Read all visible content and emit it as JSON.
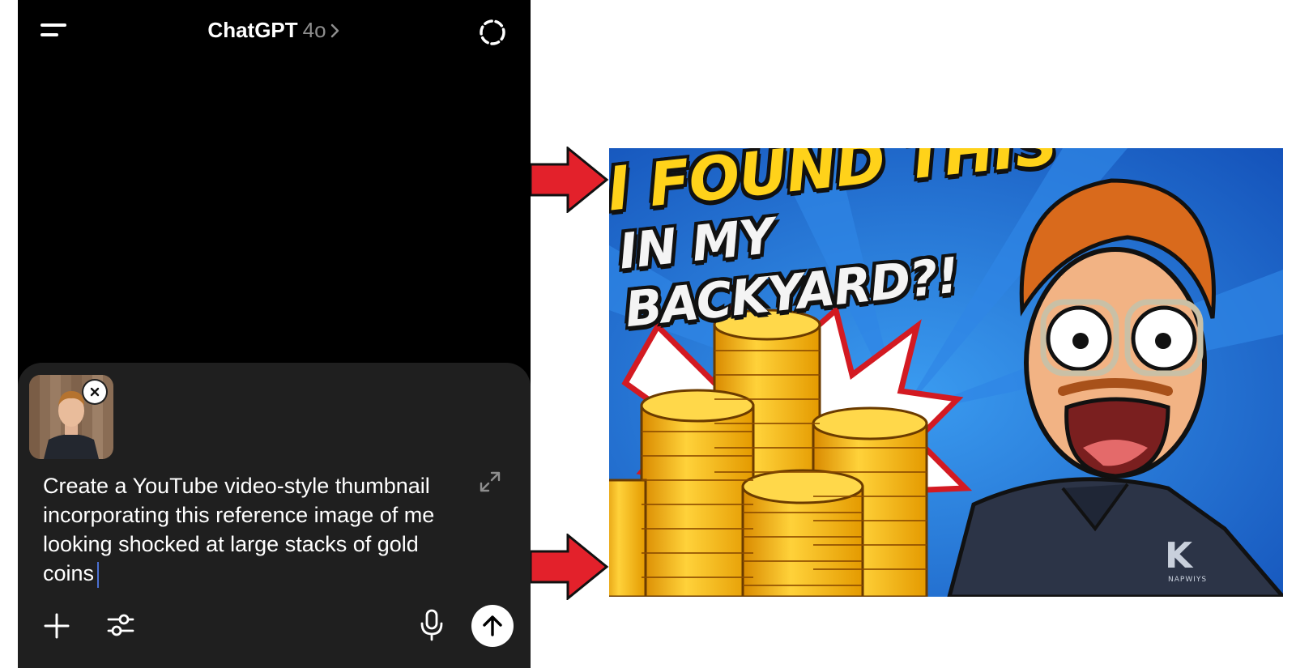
{
  "header": {
    "title": "ChatGPT",
    "model": "4o",
    "menu_icon": "menu-icon",
    "chat_icon": "temporary-chat-icon"
  },
  "composer": {
    "attachment": {
      "kind": "reference-photo",
      "close_icon": "close-icon"
    },
    "prompt_text": "Create a YouTube video-style thumbnail incorporating this reference image of me looking shocked at large stacks of gold coins",
    "expand_icon": "expand-icon",
    "plus_icon": "plus-icon",
    "tools_icon": "sliders-icon",
    "mic_icon": "microphone-icon",
    "send_icon": "arrow-up-icon"
  },
  "annotations": {
    "arrow_color": "#e3212b"
  },
  "thumbnail": {
    "headline_line1": "I FOUND THIS",
    "headline_line2": "IN MY BACKYARD?!",
    "shirt_logo": "K",
    "shirt_text": "NAPWIYS",
    "colors": {
      "background": "#1c6cd4",
      "coins": "#f5b800",
      "headline": "#ffd21a"
    }
  }
}
